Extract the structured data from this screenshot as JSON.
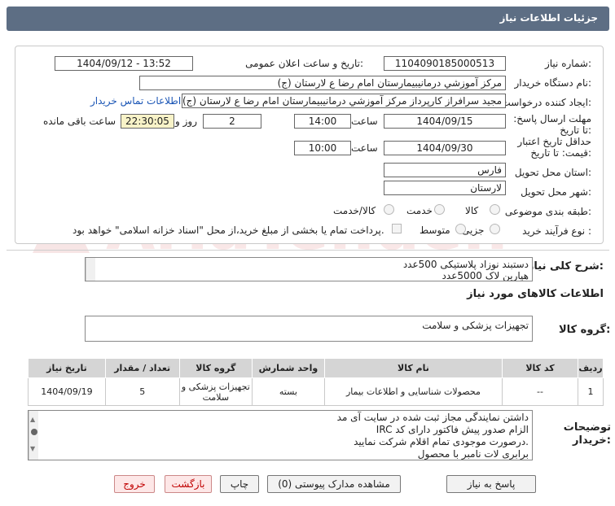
{
  "window_title": "جزئیات اطلاعات نیاز",
  "fields": {
    "need_number_label": "شماره نیاز:",
    "need_number": "1104090185000513",
    "announce_label": "تاریخ و ساعت اعلان عمومی:",
    "announce_value": "1404/09/12 - 13:52",
    "buyer_org_label": "نام دستگاه خریدار:",
    "buyer_org": "مرکز آموزشي درمانیبیمارستان امام رضا  ع  لارستان (ج)",
    "requester_label": "ایجاد کننده درخواست:",
    "requester": "مجید سرافراز کارپرداز  مرکز آموزشي درمانیبیمارستان امام رضا  ع  لارستان (ج)",
    "contact_link": "اطلاعات تماس خریدار",
    "deadline_label": "مهلت ارسال پاسخ: تا تاریخ:",
    "deadline_date": "1404/09/15",
    "time_label": "ساعت",
    "deadline_time": "14:00",
    "days_value": "2",
    "days_label": "روز و",
    "remaining_value": "22:30:05",
    "remaining_label": "ساعت باقی مانده",
    "validity_label": "حداقل تاریخ اعتبار قیمت: تا تاریخ:",
    "validity_date": "1404/09/30",
    "validity_time_label": "ساعت",
    "validity_time": "10:00",
    "province_label": "استان محل تحویل:",
    "province": "فارس",
    "city_label": "شهر محل تحویل:",
    "city": "لارستان",
    "category_label": "طبقه بندی موضوعی:",
    "category_options": [
      "کالا",
      "خدمت",
      "کالا/خدمت"
    ],
    "process_label": "نوع فرآیند خرید :",
    "process_options": [
      "جزیی",
      "متوسط"
    ],
    "payment_note": "پرداخت تمام یا بخشی از مبلغ خرید،از محل \"اسناد خزانه اسلامی\" خواهد بود."
  },
  "summary": {
    "label": "شرح کلی نیاز:",
    "line1": "دستبند نوزاد پلاستیکی      500عدد",
    "line2": "هپارین لاک         5000عدد"
  },
  "goods_info": {
    "heading": "اطلاعات کالاهای مورد نیاز",
    "group_label": "گروه کالا:",
    "group_value": "تجهیزات پزشکی و سلامت"
  },
  "table": {
    "headers": [
      "ردیف",
      "کد کالا",
      "نام کالا",
      "واحد شمارش",
      "گروه کالا",
      "تعداد / مقدار",
      "تاریخ نیاز"
    ],
    "rows": [
      [
        "1",
        "--",
        "محصولات شناسایی و اطلاعات بیمار",
        "بسته",
        "تجهیزات پزشکی و سلامت",
        "5",
        "1404/09/19"
      ]
    ]
  },
  "buyer_notes": {
    "label": "توضیحات خریدار:",
    "lines": [
      "داشتن نمایندگی مجاز ثبت شده در سایت آی مد",
      "الزام صدور پیش فاکتور دارای کد IRC",
      ".درصورت موجودی تمام اقلام شرکت نمایید",
      "برابری لات نامبر با محصول"
    ]
  },
  "buttons": {
    "reply": "پاسخ به نیاز",
    "attachments": "مشاهده مدارک پیوستی (0)",
    "print": "چاپ",
    "back": "بازگشت",
    "exit": "خروج"
  },
  "watermark_text": "AriaTender.net",
  "colors": {
    "title_bar": "#5d6e84",
    "link": "#1a55b5",
    "highlight": "#f8f3c8",
    "table_header": "#d5d5d5"
  }
}
